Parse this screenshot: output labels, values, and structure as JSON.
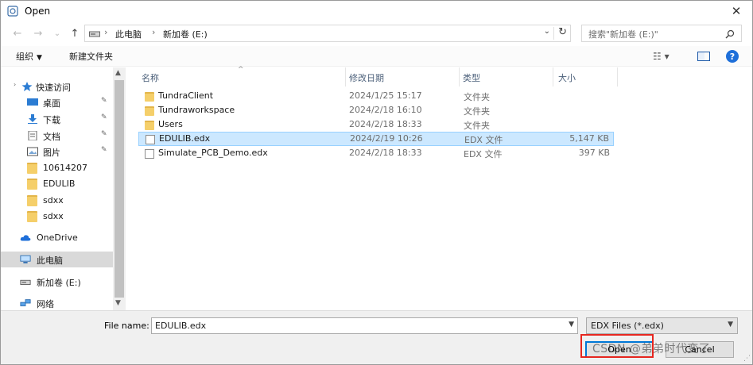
{
  "window": {
    "title": "Open",
    "close_glyph": "✕"
  },
  "nav": {
    "back_glyph": "←",
    "forward_glyph": "→",
    "recent_glyph": "⌄",
    "up_glyph": "↑"
  },
  "address": {
    "crumbs": [
      "此电脑",
      "新加卷 (E:)"
    ],
    "separator": "›",
    "refresh_glyph": "↻"
  },
  "search": {
    "placeholder": "搜索\"新加卷 (E:)\""
  },
  "toolbar": {
    "organize": "组织",
    "new_folder": "新建文件夹",
    "views_glyph": "☷ ▾",
    "help": "?"
  },
  "sidebar": {
    "items": [
      {
        "label": "快速访问",
        "icon": "star-icon"
      },
      {
        "label": "桌面",
        "icon": "desktop-icon",
        "pinned": true
      },
      {
        "label": "下载",
        "icon": "download-icon",
        "pinned": true
      },
      {
        "label": "文档",
        "icon": "document-icon",
        "pinned": true
      },
      {
        "label": "图片",
        "icon": "picture-icon",
        "pinned": true
      },
      {
        "label": "10614207",
        "icon": "folder-icon"
      },
      {
        "label": "EDULIB",
        "icon": "folder-icon"
      },
      {
        "label": "sdxx",
        "icon": "folder-icon"
      },
      {
        "label": "sdxx",
        "icon": "folder-icon"
      },
      {
        "label": "OneDrive",
        "icon": "cloud-icon"
      },
      {
        "label": "此电脑",
        "icon": "computer-icon",
        "selected": true
      },
      {
        "label": "新加卷 (E:)",
        "icon": "drive-icon"
      },
      {
        "label": "网络",
        "icon": "network-icon"
      }
    ],
    "pin_glyph": "📌"
  },
  "columns": {
    "name": "名称",
    "modified": "修改日期",
    "type": "类型",
    "size": "大小"
  },
  "files": [
    {
      "name": "TundraClient",
      "modified": "2024/1/25 15:17",
      "type": "文件夹",
      "size": "",
      "kind": "folder"
    },
    {
      "name": "Tundraworkspace",
      "modified": "2024/2/18 16:10",
      "type": "文件夹",
      "size": "",
      "kind": "folder"
    },
    {
      "name": "Users",
      "modified": "2024/2/18 18:33",
      "type": "文件夹",
      "size": "",
      "kind": "folder"
    },
    {
      "name": "EDULIB.edx",
      "modified": "2024/2/19 10:26",
      "type": "EDX 文件",
      "size": "5,147 KB",
      "kind": "file",
      "selected": true
    },
    {
      "name": "Simulate_PCB_Demo.edx",
      "modified": "2024/2/18 18:33",
      "type": "EDX 文件",
      "size": "397 KB",
      "kind": "file"
    }
  ],
  "footer": {
    "filename_label": "File name:",
    "filename_value": "EDULIB.edx",
    "filter_value": "EDX Files (*.edx)",
    "open_label": "Open",
    "cancel_label": "Cancel",
    "watermark": "CSDN @弟弟时代变了"
  },
  "colors": {
    "accent": "#0078d7",
    "selection": "#cce8ff",
    "highlight_box": "#e6261f"
  }
}
